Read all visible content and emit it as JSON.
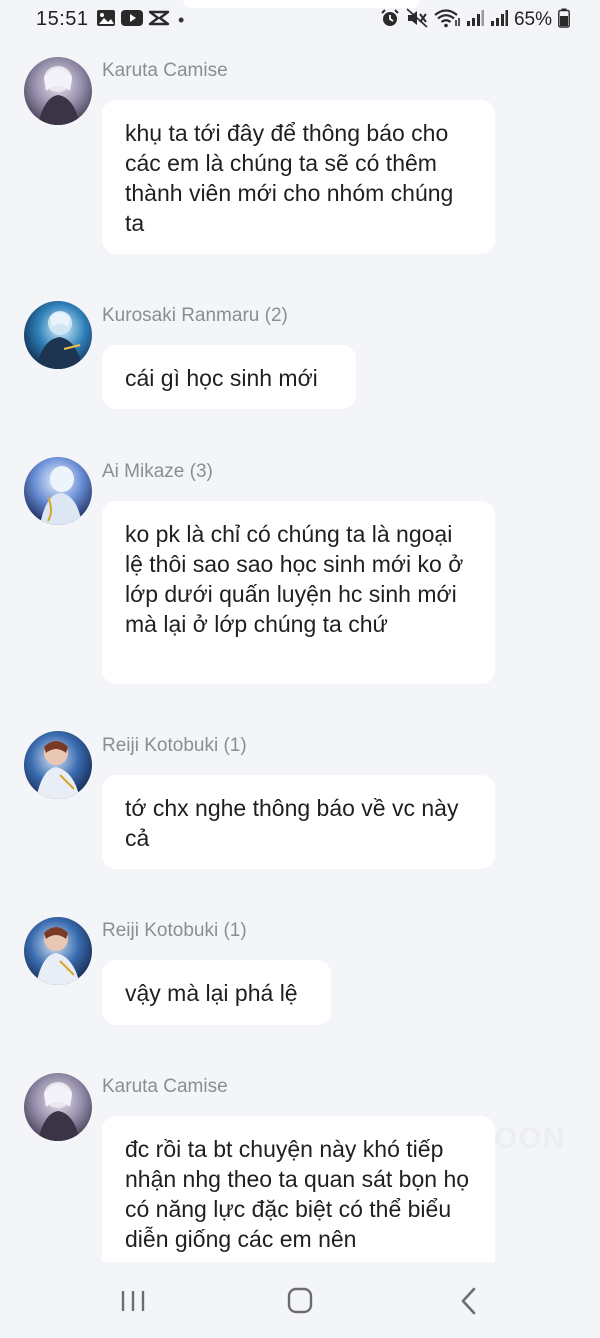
{
  "status_bar": {
    "time": "15:51",
    "notification_dot": "•",
    "battery": "65%",
    "notification_icons": [
      "gallery-icon",
      "youtube-icon",
      "capcut-icon"
    ],
    "system_icons": [
      "alarm-icon",
      "mute-icon",
      "wifi-icon",
      "signal-icon",
      "signal-icon",
      "battery-icon"
    ]
  },
  "messages": [
    {
      "sender": "Karuta Camise",
      "text": "khụ ta tới đây để thông báo cho các em là chúng ta sẽ có thêm thành viên mới cho nhóm chúng ta",
      "avatar": "avatar-karuta"
    },
    {
      "sender": "Kurosaki Ranmaru (2)",
      "text": "cái gì học sinh mới",
      "avatar": "avatar-ranmaru"
    },
    {
      "sender": "Ai Mikaze (3)",
      "text": "ko pk là chỉ có chúng ta là ngoại lệ thôi sao sao học sinh mới ko ở lớp dưới quấn luyện hc sinh mới mà lại ở lớp chúng ta chứ",
      "avatar": "avatar-ai"
    },
    {
      "sender": "Reiji Kotobuki (1)",
      "text": "tớ chx nghe thông báo về vc này cả",
      "avatar": "avatar-reiji"
    },
    {
      "sender": "Reiji Kotobuki (1)",
      "text": "vậy mà lại phá lệ",
      "avatar": "avatar-reiji"
    },
    {
      "sender": "Karuta Camise",
      "text": "đc rồi ta bt chuyện này khó tiếp nhận nhg theo ta quan sát bọn họ có năng lực đặc biệt có thể biểu diễn giống các em nên",
      "avatar": "avatar-karuta"
    }
  ],
  "watermark": "OON",
  "nav": {
    "recents": "recents-icon",
    "home": "home-icon",
    "back": "back-icon"
  },
  "colors": {
    "background": "#f4f5f9",
    "bubble": "#ffffff",
    "sender_text": "#8a8d94",
    "message_text": "#1e1f22"
  }
}
